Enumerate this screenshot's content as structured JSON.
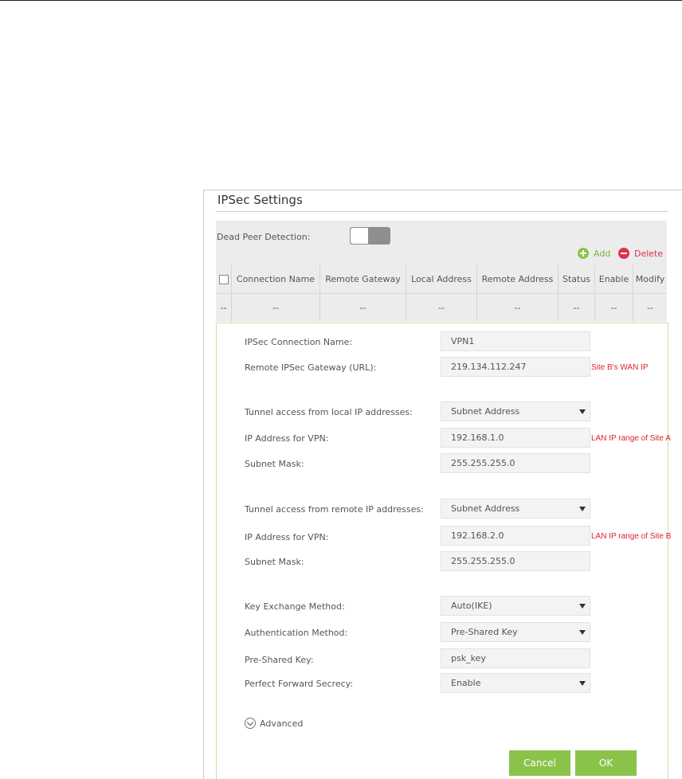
{
  "title": "IPSec Settings",
  "dpd": {
    "label": "Dead Peer Detection:",
    "enabled": false
  },
  "actions": {
    "add": "Add",
    "delete": "Delete"
  },
  "table": {
    "headers": [
      "Connection Name",
      "Remote Gateway",
      "Local Address",
      "Remote Address",
      "Status",
      "Enable",
      "Modify"
    ],
    "row": [
      "--",
      "--",
      "--",
      "--",
      "--",
      "--",
      "--",
      "--"
    ]
  },
  "form": {
    "conn_name": {
      "label": "IPSec Connection Name:",
      "value": "VPN1"
    },
    "remote_gw": {
      "label": "Remote IPSec Gateway (URL):",
      "value": "219.134.112.247",
      "note": "Site B's WAN IP"
    },
    "local_access": {
      "label": "Tunnel access from local IP addresses:",
      "value": "Subnet Address"
    },
    "local_ip": {
      "label": "IP Address for VPN:",
      "value": "192.168.1.0",
      "note": "LAN IP range of Site A"
    },
    "local_mask": {
      "label": "Subnet Mask:",
      "value": "255.255.255.0"
    },
    "remote_access": {
      "label": "Tunnel access from remote IP addresses:",
      "value": "Subnet Address"
    },
    "remote_ip": {
      "label": "IP Address for VPN:",
      "value": "192.168.2.0",
      "note": "LAN IP range of Site B"
    },
    "remote_mask": {
      "label": "Subnet Mask:",
      "value": "255.255.255.0"
    },
    "key_exchange": {
      "label": "Key Exchange Method:",
      "value": "Auto(IKE)"
    },
    "auth": {
      "label": "Authentication Method:",
      "value": "Pre-Shared Key"
    },
    "psk": {
      "label": "Pre-Shared Key:",
      "value": "psk_key"
    },
    "pfs": {
      "label": "Perfect Forward Secrecy:",
      "value": "Enable"
    },
    "advanced": "Advanced"
  },
  "buttons": {
    "cancel": "Cancel",
    "ok": "OK"
  },
  "colors": {
    "accent": "#8bc34a",
    "delete": "#e0304a",
    "note": "#e0202a"
  }
}
